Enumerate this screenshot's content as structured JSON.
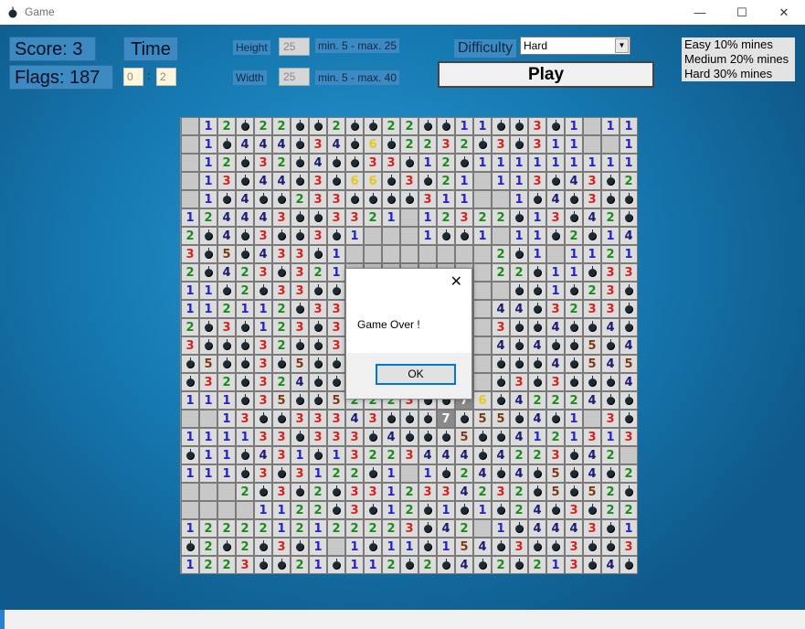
{
  "window": {
    "title": "Game",
    "min_glyph": "—",
    "max_glyph": "☐",
    "close_glyph": "✕"
  },
  "score": {
    "label": "Score: 3"
  },
  "flags": {
    "label": "Flags: 187"
  },
  "time": {
    "label": "Time",
    "minutes": "0",
    "seconds": "2",
    "separator": ":"
  },
  "height": {
    "label": "Height",
    "value": "25",
    "hint": "min. 5 - max. 25"
  },
  "width": {
    "label": "Width",
    "value": "25",
    "hint": "min. 5 - max. 40"
  },
  "difficulty": {
    "label": "Difficulty",
    "selected": "Hard",
    "arrow": "▼"
  },
  "play": {
    "label": "Play"
  },
  "legend": {
    "easy": "Easy 10% mines",
    "medium": "Medium 20% mines",
    "hard": "Hard 30% mines"
  },
  "dialog": {
    "close_glyph": "✕",
    "message": "Game Over !",
    "ok_label": "OK"
  },
  "board": {
    "rows": [
      "_12*22**2**22**11**3*1_11",
      "_1*444*34*6*2232*3*311__1*",
      "_12*32*4**33*12*11111111122",
      "_13*44*3*66*3*21_113*43*2",
      "_1*4**233****311__1*4*3**4*",
      "124443**3321_12322*13*42*4",
      "2*4*3**3*1___1**1_11*2*14",
      "3*5*433*1________2*1_1121*3*",
      "2*423*321________22*11*33*42",
      "11*2*33***________**1*23*1",
      "112112*332_______44*3233*421",
      "2*3*123*31_______3**4**4*42",
      "3***32**3*_______4*4**5*4*4",
      "*5**3*5**5_______***4*545*",
      "*32*324**3_______*3*3***4*",
      "111*35**52223**76*42224**6",
      "__13**33343***7*55*4*1_3**2",
      "111133*333*4***5**4121313*1",
      "*11*431*13223444*4223*42_",
      "111*3*3122*1_1*24*4*5*4*21",
      "___2*3*2*3312334232*5*52*",
      "____1122*3*12*1*1*24*3*222",
      "1222212122223*42_1*4443*1",
      "*2*2*3*1_1*11*154*3**3**3*",
      "1223**21*112*2*4*2*213*4*1"
    ]
  }
}
